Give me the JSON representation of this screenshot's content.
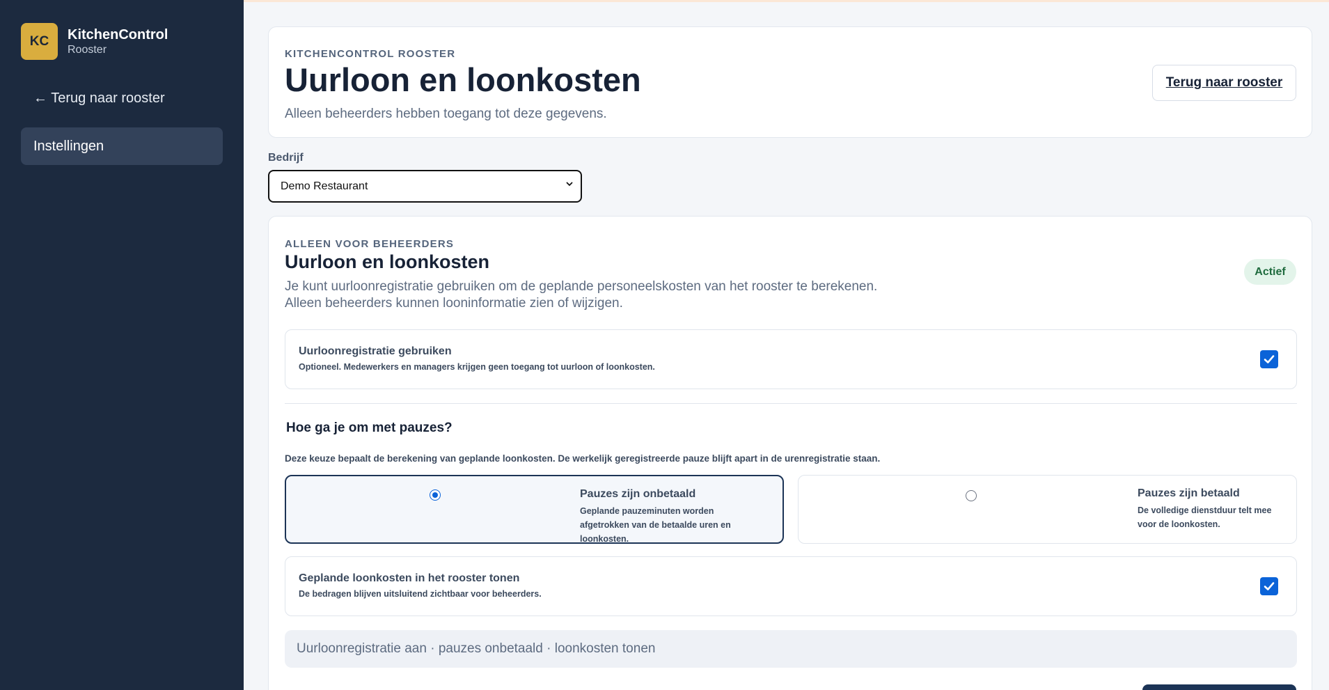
{
  "sidebar": {
    "logo": "KC",
    "app_name": "KitchenControl",
    "app_sub": "Rooster",
    "back_link": "← Terug naar rooster",
    "items": [
      {
        "label": "Instellingen"
      }
    ]
  },
  "header": {
    "eyebrow": "KITCHENCONTROL ROOSTER",
    "title": "Uurloon en loonkosten",
    "subtitle": "Alleen beheerders hebben toegang tot deze gegevens.",
    "back_button": "Terug naar rooster"
  },
  "company": {
    "label": "Bedrijf",
    "selected": "Demo Restaurant"
  },
  "settings": {
    "eyebrow": "ALLEEN VOOR BEHEERDERS",
    "title": "Uurloon en loonkosten",
    "desc_line1": "Je kunt uurloonregistratie gebruiken om de geplande personeelskosten van het rooster te berekenen.",
    "desc_line2": "Alleen beheerders kunnen looninformatie zien of wijzigen.",
    "status_badge": "Actief",
    "use_wage": {
      "title": "Uurloonregistratie gebruiken",
      "help": "Optioneel. Medewerkers en managers krijgen geen toegang tot uurloon of loonkosten.",
      "checked": true
    },
    "pauses": {
      "title": "Hoe ga je om met pauzes?",
      "help": "Deze keuze bepaalt de berekening van geplande loonkosten. De werkelijk geregistreerde pauze blijft apart in de urenregistratie staan.",
      "options": [
        {
          "title": "Pauzes zijn onbetaald",
          "help": "Geplande pauzeminuten worden afgetrokken van de betaalde uren en loonkosten.",
          "selected": true
        },
        {
          "title": "Pauzes zijn betaald",
          "help": "De volledige dienstduur telt mee voor de loonkosten.",
          "selected": false
        }
      ]
    },
    "show_costs": {
      "title": "Geplande loonkosten in het rooster tonen",
      "help": "De bedragen blijven uitsluitend zichtbaar voor beheerders.",
      "checked": true
    },
    "summary": "Uurloonregistratie aan · pauzes onbetaald · loonkosten tonen"
  },
  "colors": {
    "sidebar": "#1c2a3f",
    "accent": "#0b63d8",
    "logo": "#d9ad3e",
    "primary_button": "#1c3456"
  }
}
